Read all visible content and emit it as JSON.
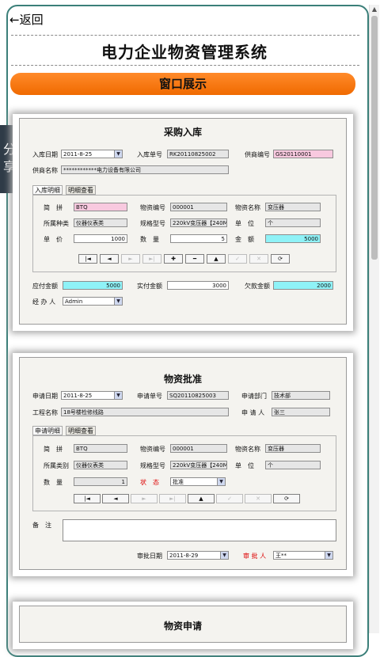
{
  "nav": {
    "back": "←返回",
    "title": "电力企业物资管理系统",
    "banner": "窗口展示",
    "share": "分享"
  },
  "nav_buttons": [
    "|◄",
    "◄",
    "►",
    "►|",
    "✚",
    "━",
    "▲",
    "✓",
    "✕",
    "⟳"
  ],
  "card1": {
    "title": "采购入库",
    "l_date": "入库日期",
    "v_date": "2011-8-25",
    "l_no": "入库单号",
    "v_no": "RK20110825002",
    "l_sup": "供商编号",
    "v_sup": "GS20110001",
    "l_name": "供商名称",
    "v_name": "************电力设备有限公司",
    "tab1": "入库明细",
    "tab2": "明细查看",
    "l_jp": "简　拼",
    "v_jp": "BTQ",
    "l_code": "物资编号",
    "v_code": "000001",
    "l_mname": "物资名称",
    "v_mname": "变压器",
    "l_cat": "所属种类",
    "v_cat": "仪器仪表类",
    "l_spec": "规格型号",
    "v_spec": "220kV变压器【240M",
    "l_unit": "单　位",
    "v_unit": "个",
    "l_price": "单　价",
    "v_price": "1000",
    "l_qty": "数　量",
    "v_qty": "5",
    "l_amt": "金　额",
    "v_amt": "5000",
    "l_pay": "应付金额",
    "v_pay": "5000",
    "l_paid": "实付金额",
    "v_paid": "3000",
    "l_owe": "欠款金额",
    "v_owe": "2000",
    "l_op": "经 办 人",
    "v_op": "Admin"
  },
  "card2": {
    "title": "物资批准",
    "l_date": "申请日期",
    "v_date": "2011-8-25",
    "l_no": "申请单号",
    "v_no": "SQ20110825003",
    "l_dept": "申请部门",
    "v_dept": "技术部",
    "l_proj": "工程名称",
    "v_proj": "18号楼检修线路",
    "l_app": "申 请 人",
    "v_app": "张三",
    "tab1": "申请明细",
    "tab2": "明细查看",
    "l_jp": "简　拼",
    "v_jp": "BTQ",
    "l_code": "物资编号",
    "v_code": "000001",
    "l_mname": "物资名称",
    "v_mname": "变压器",
    "l_cat": "所属类别",
    "v_cat": "仪器仪表类",
    "l_spec": "规格型号",
    "v_spec": "220kV变压器【240M",
    "l_unit": "单　位",
    "v_unit": "个",
    "l_qty": "数　量",
    "v_qty": "1",
    "l_status": "状　态",
    "v_status": "批准",
    "l_note": "备　注",
    "l_adate": "审批日期",
    "v_adate": "2011-8-29",
    "l_appr": "审 批 人",
    "v_appr": "王**"
  },
  "card3": {
    "title": "物资申请"
  }
}
